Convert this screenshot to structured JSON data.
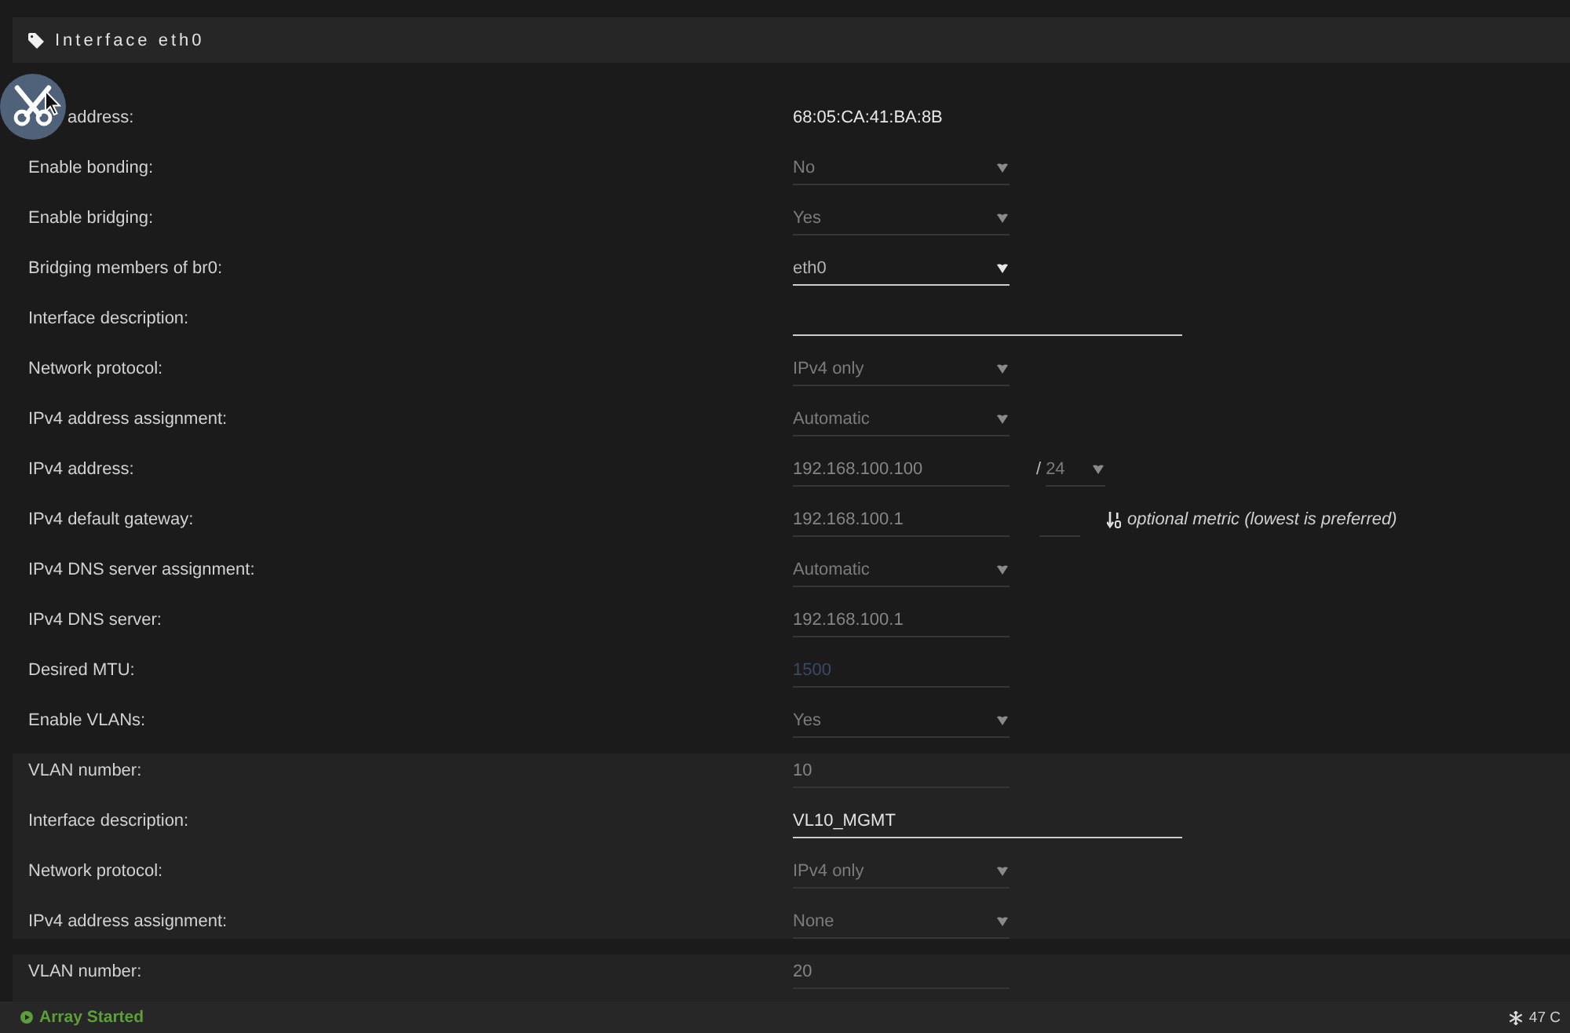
{
  "section": {
    "title": "Interface eth0"
  },
  "fields": [
    {
      "label": "address:",
      "covered": true,
      "kind": "static",
      "value": "68:05:CA:41:BA:8B"
    },
    {
      "label": "Enable bonding:",
      "kind": "select",
      "value": "No",
      "disabled": true
    },
    {
      "label": "Enable bridging:",
      "kind": "select",
      "value": "Yes",
      "disabled": true
    },
    {
      "label": "Bridging members of br0:",
      "kind": "select",
      "value": "eth0",
      "disabled": false
    },
    {
      "label": "Interface description:",
      "kind": "long_text",
      "disabled": false
    },
    {
      "label": "Network protocol:",
      "kind": "select",
      "value": "IPv4 only",
      "disabled": true
    },
    {
      "label": "IPv4 address assignment:",
      "kind": "select",
      "value": "Automatic",
      "disabled": true
    },
    {
      "label": "IPv4 address:",
      "kind": "address",
      "value": "192.168.100.100",
      "disabled": true,
      "separator": "/",
      "netmask": {
        "value": "24",
        "disabled": true
      }
    },
    {
      "label": "IPv4 default gateway:",
      "kind": "gateway",
      "value": "192.168.100.1",
      "disabled": true,
      "metric": {
        "disabled": true
      },
      "hint": "optional metric (lowest is preferred)"
    },
    {
      "label": "IPv4 DNS server assignment:",
      "kind": "select",
      "value": "Automatic",
      "disabled": true
    },
    {
      "label": "IPv4 DNS server:",
      "kind": "text",
      "value": "192.168.100.1",
      "disabled": true
    },
    {
      "label": "Desired MTU:",
      "kind": "text",
      "placeholder": "1500",
      "disabled": true
    },
    {
      "label": "Enable VLANs:",
      "kind": "select",
      "value": "Yes",
      "disabled": true
    }
  ],
  "vlans": [
    {
      "fields": [
        {
          "label": "VLAN number:",
          "kind": "text",
          "value": "10",
          "disabled": true
        },
        {
          "label": "Interface description:",
          "kind": "long_text",
          "value": "VL10_MGMT",
          "disabled": false
        },
        {
          "label": "Network protocol:",
          "kind": "select",
          "value": "IPv4 only",
          "disabled": true
        },
        {
          "label": "IPv4 address assignment:",
          "kind": "select",
          "value": "None",
          "disabled": true
        }
      ]
    },
    {
      "fields": [
        {
          "label": "VLAN number:",
          "kind": "text",
          "value": "20",
          "disabled": true
        }
      ]
    }
  ],
  "status_bar": {
    "array_status": "Array Started",
    "temperature": "47 C"
  }
}
